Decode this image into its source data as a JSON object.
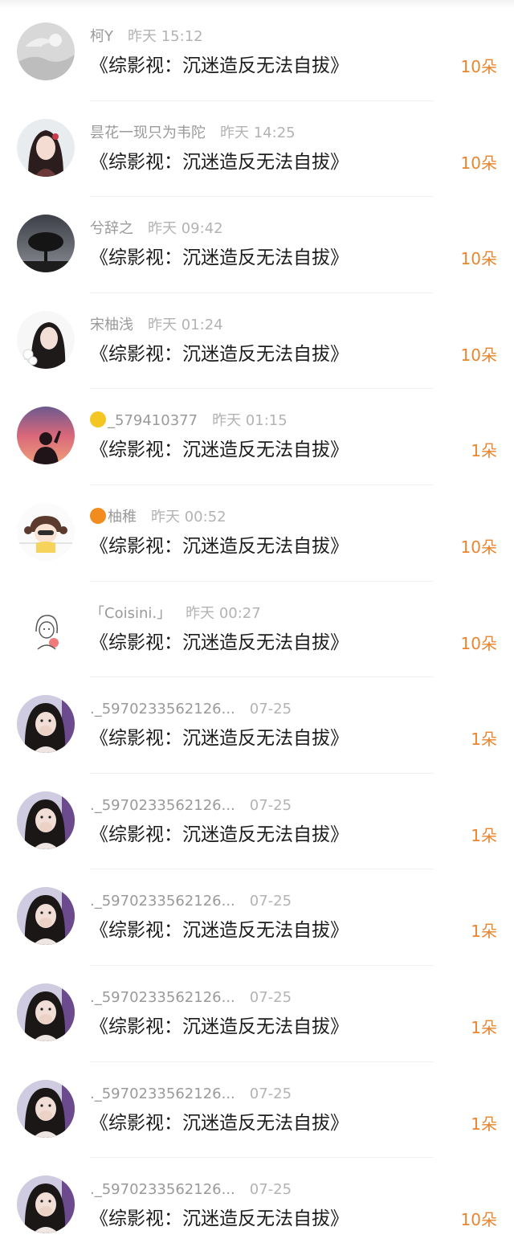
{
  "rows": [
    {
      "name": "柯Y",
      "time": "昨天 15:12",
      "title": "《综影视：沉迷造反无法自拔》",
      "gift": "10朵",
      "avatar": "gray-landscape-avatar"
    },
    {
      "name": "昙花一现只为韦陀",
      "time": "昨天 14:25",
      "title": "《综影视：沉迷造反无法自拔》",
      "gift": "10朵",
      "avatar": "girl-portrait-avatar"
    },
    {
      "name": "兮辞之",
      "time": "昨天 09:42",
      "title": "《综影视：沉迷造反无法自拔》",
      "gift": "10朵",
      "avatar": "tree-silhouette-avatar"
    },
    {
      "name": "宋柚浅",
      "time": "昨天 01:24",
      "title": "《综影视：沉迷造反无法自拔》",
      "gift": "10朵",
      "avatar": "girl-flowers-avatar"
    },
    {
      "name": "_579410377",
      "time": "昨天 01:15",
      "title": "《综影视：沉迷造反无法自拔》",
      "gift": "1朵",
      "avatar": "sunset-silhouette-avatar",
      "emoji": "lemon-emoji"
    },
    {
      "name": "柚稚",
      "time": "昨天 00:52",
      "title": "《综影视：沉迷造反无法自拔》",
      "gift": "10朵",
      "avatar": "cartoon-girl-avatar",
      "emoji": "orange-emoji"
    },
    {
      "name": "「Coisini.」",
      "time": "昨天 00:27",
      "title": "《综影视：沉迷造反无法自拔》",
      "gift": "10朵",
      "avatar": "sketch-girl-avatar"
    },
    {
      "name": "._5970233562126...",
      "time": "07-25",
      "title": "《综影视：沉迷造反无法自拔》",
      "gift": "1朵",
      "avatar": "girl-covering-mouth-avatar"
    },
    {
      "name": "._5970233562126...",
      "time": "07-25",
      "title": "《综影视：沉迷造反无法自拔》",
      "gift": "1朵",
      "avatar": "girl-covering-mouth-avatar"
    },
    {
      "name": "._5970233562126...",
      "time": "07-25",
      "title": "《综影视：沉迷造反无法自拔》",
      "gift": "1朵",
      "avatar": "girl-covering-mouth-avatar"
    },
    {
      "name": "._5970233562126...",
      "time": "07-25",
      "title": "《综影视：沉迷造反无法自拔》",
      "gift": "1朵",
      "avatar": "girl-covering-mouth-avatar"
    },
    {
      "name": "._5970233562126...",
      "time": "07-25",
      "title": "《综影视：沉迷造反无法自拔》",
      "gift": "1朵",
      "avatar": "girl-covering-mouth-avatar"
    },
    {
      "name": "._5970233562126...",
      "time": "07-25",
      "title": "《综影视：沉迷造反无法自拔》",
      "gift": "10朵",
      "avatar": "girl-covering-mouth-avatar"
    }
  ],
  "colors": {
    "gift": "#e8852e",
    "name": "#9a9a9a",
    "title": "#1c1c1c"
  }
}
